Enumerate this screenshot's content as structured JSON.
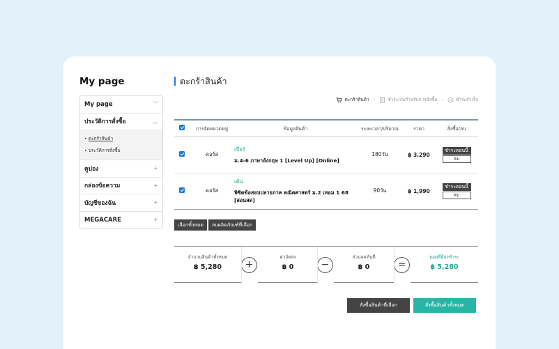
{
  "page_title": "My page",
  "sidebar": {
    "items": [
      {
        "label": "My page",
        "symbol": "﹀"
      },
      {
        "label": "ประวัติการสั่งซื้อ",
        "symbol": "︿"
      },
      {
        "label": "คูปอง",
        "symbol": "+"
      },
      {
        "label": "กล่องข้อความ",
        "symbol": "+"
      },
      {
        "label": "บัญชีของฉัน",
        "symbol": "+"
      },
      {
        "label": "MEGACARE",
        "symbol": "+"
      }
    ],
    "subitems": [
      {
        "label": "ตะกร้าสินค้า",
        "active": true
      },
      {
        "label": "ประวัติการสั่งซื้อ",
        "active": false
      }
    ]
  },
  "cart": {
    "title": "ตะกร้าสินค้า",
    "steps": [
      "ตะกร้าสินค้า",
      "ชำระเงินสำหรับการสั่งซื้อ",
      "ชำระสำเร็จ"
    ],
    "headers": [
      "การจัดหมวดหมู่",
      "ข้อมูลสินค้า",
      "ระยะเวลา/ปริมาณ",
      "ราคา",
      "สั่งซื้อ/ลบ"
    ],
    "rows": [
      {
        "category": "คอร์ส",
        "tutor": "เบียร์",
        "course": "ม.4-6 ภาษาอังกฤษ 1 [Level Up] [Online]",
        "duration": "180วัน",
        "price": "฿ 3,290",
        "pay_label": "ชำระตอนนี้",
        "delete_label": "ลบ"
      },
      {
        "category": "คอร์ส",
        "tutor": "เต้น",
        "course": "พิชิตข้อสอบปลายภาค คณิตศาสตร์ ม.2 เทอม 1 68 [สอนสด]",
        "duration": "90วัน",
        "price": "฿ 1,990",
        "pay_label": "ชำระตอนนี้",
        "delete_label": "ลบ"
      }
    ],
    "select_all_label": "เลือกทั้งหมด",
    "delete_selected_label": "ลบผลิตภัณฑ์ที่เลือก"
  },
  "summary": {
    "total_label": "จำนวนสินค้าทั้งหมด",
    "total_value": "฿ 5,280",
    "shipping_label": "ค่าจัดส่ง",
    "shipping_value": "฿ 0",
    "discount_label": "ส่วนลดทันที",
    "discount_value": "฿ 0",
    "due_label": "ยอดที่ต้องชำระ",
    "due_value": "฿ 5,280",
    "op_plus": "+",
    "op_minus": "−",
    "op_equals": "="
  },
  "actions": {
    "buy_selected": "สั่งซื้อสินค้าที่เลือก",
    "buy_all": "สั่งซื้อสินค้าทั้งหมด"
  },
  "colors": {
    "accent": "#1e7ad6",
    "teal": "#26b6a6",
    "dark_button": "#444444",
    "background": "#e3f1fb"
  }
}
